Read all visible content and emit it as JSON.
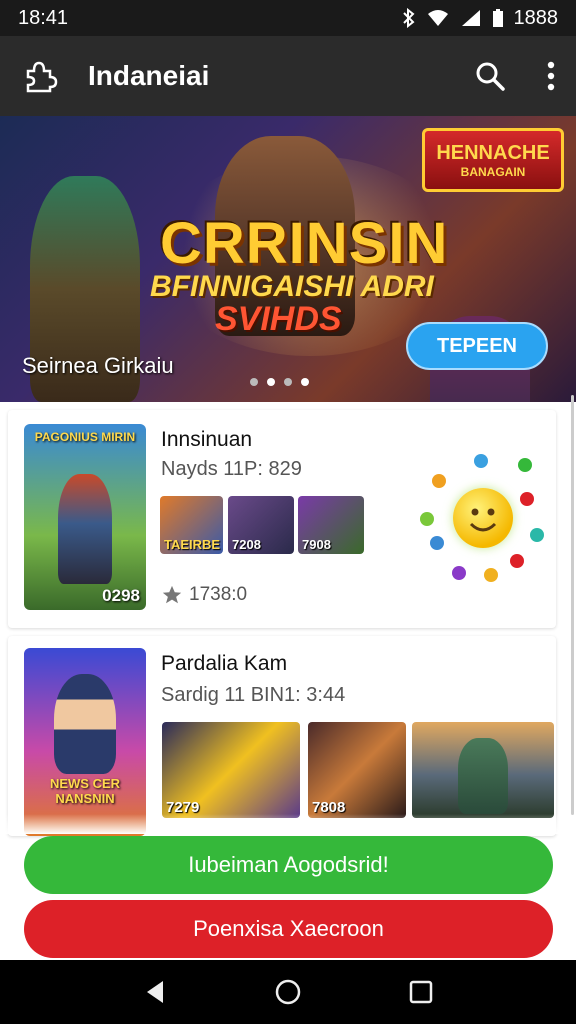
{
  "status_bar": {
    "time": "18:41",
    "battery": "1888",
    "icons": [
      "bluetooth-icon",
      "wifi-icon",
      "signal-icon",
      "battery-icon"
    ]
  },
  "app_bar": {
    "title": "Indaneiai",
    "icons": [
      "puzzle-icon",
      "search-icon",
      "more-vert-icon"
    ]
  },
  "hero": {
    "title_main": "CRRINSIN",
    "title_sub1": "BFINNIGAISHI ADRI",
    "title_sub2": "SVIHDS",
    "badge_line1": "HENNACHE",
    "badge_line2": "BANAGAIN",
    "caption": "Seirnea Girkaiu",
    "button_label": "TEPEEN",
    "slide_count": 4,
    "active_slide": 1
  },
  "cards": [
    {
      "title": "Innsinuan",
      "subtitle": "Nayds 11P: 829",
      "thumb_label_top": "PAGONIUS MIRIN",
      "thumb_badge": "0298",
      "screenshots": [
        {
          "label": "TAEIRBE"
        },
        {
          "label": "7208"
        },
        {
          "label": "7908"
        }
      ],
      "rating": "1738:0"
    },
    {
      "title": "Pardalia Kam",
      "subtitle": "Sardig 11 BIN1: 3:44",
      "thumb_label": "NEWS CER NANSNIN",
      "screenshots": [
        {
          "label": "7279"
        },
        {
          "label": "7808"
        },
        {
          "label": ""
        }
      ]
    }
  ],
  "buttons": {
    "primary": "Iubeiman Aogodsrid!",
    "secondary": "Poenxisa Xaecroon"
  },
  "colors": {
    "green": "#35b83a",
    "red": "#dd2128",
    "accent_blue": "#2aa3f0"
  }
}
